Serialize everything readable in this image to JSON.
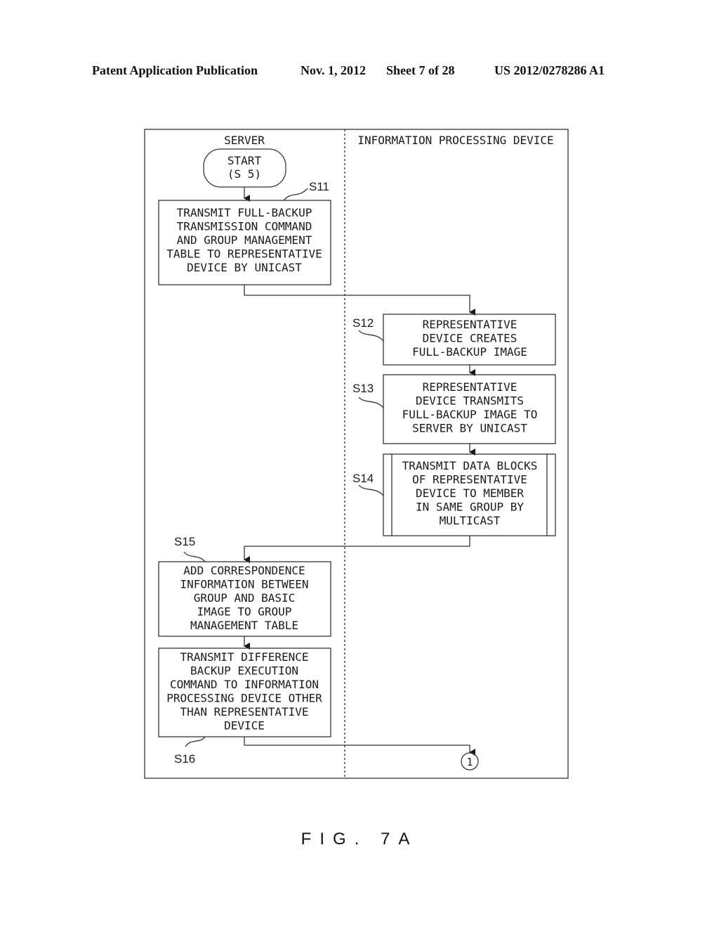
{
  "header": {
    "publication": "Patent Application Publication",
    "date": "Nov. 1, 2012",
    "sheet": "Sheet 7 of 28",
    "number": "US 2012/0278286 A1"
  },
  "lanes": {
    "left": "SERVER",
    "right": "INFORMATION PROCESSING DEVICE"
  },
  "start": {
    "line1": "START",
    "line2": "(S 5)"
  },
  "steps": {
    "s11": {
      "label": "S11",
      "lines": [
        "TRANSMIT FULL-BACKUP",
        "TRANSMISSION COMMAND",
        "AND GROUP MANAGEMENT",
        "TABLE TO REPRESENTATIVE",
        "DEVICE BY UNICAST"
      ]
    },
    "s12": {
      "label": "S12",
      "lines": [
        "REPRESENTATIVE",
        "DEVICE CREATES",
        "FULL-BACKUP IMAGE"
      ]
    },
    "s13": {
      "label": "S13",
      "lines": [
        "REPRESENTATIVE",
        "DEVICE TRANSMITS",
        "FULL-BACKUP IMAGE TO",
        "SERVER BY UNICAST"
      ]
    },
    "s14": {
      "label": "S14",
      "lines": [
        "TRANSMIT DATA BLOCKS",
        "OF REPRESENTATIVE",
        "DEVICE TO MEMBER",
        "IN SAME GROUP BY",
        "MULTICAST"
      ]
    },
    "s15": {
      "label": "S15",
      "lines": [
        "ADD CORRESPONDENCE",
        "INFORMATION BETWEEN",
        "GROUP AND BASIC",
        "IMAGE TO GROUP",
        "MANAGEMENT TABLE"
      ]
    },
    "s16": {
      "label": "S16",
      "lines": [
        "TRANSMIT DIFFERENCE",
        "BACKUP EXECUTION",
        "COMMAND TO INFORMATION",
        "PROCESSING DEVICE OTHER",
        "THAN REPRESENTATIVE",
        "DEVICE"
      ]
    }
  },
  "connector": "1",
  "figure_label": "FIG. 7A"
}
